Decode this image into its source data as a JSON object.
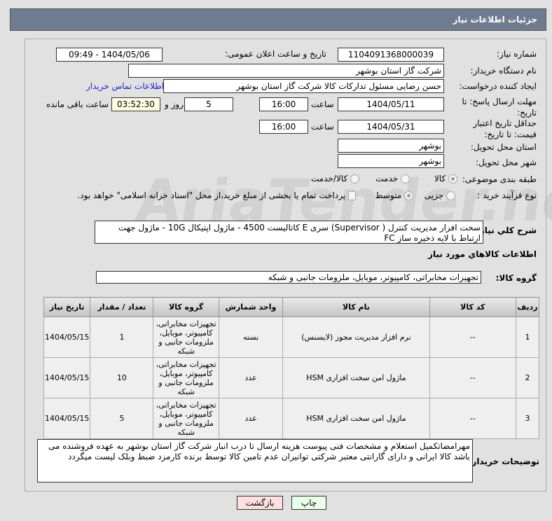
{
  "header": {
    "title": "جزئیات اطلاعات نیاز"
  },
  "watermark": "AriaTender.net",
  "fields": {
    "need_number_label": "شماره نیاز:",
    "need_number": "1104091368000039",
    "announce_label": "تاریخ و ساعت اعلان عمومی:",
    "announce_value": "1404/05/06 - 09:49",
    "buyer_org_label": "نام دستگاه خریدار:",
    "buyer_org": "شرکت گاز استان بوشهر",
    "creator_label": "ایجاد کننده درخواست:",
    "creator": "حسن رضایی مسئول تدارکات کالا شرکت گاز استان بوشهر",
    "contact_link": "اطلاعات تماس خریدار",
    "deadline_label": "مهلت ارسال پاسخ: تا تاریخ:",
    "deadline_date": "1404/05/11",
    "time_label": "ساعت",
    "deadline_time": "16:00",
    "days": "5",
    "days_label": "روز و",
    "remaining": "03:52:30",
    "remaining_label": "ساعت باقی مانده",
    "validity_label": "حداقل تاریخ اعتبار قیمت: تا تاریخ:",
    "validity_date": "1404/05/31",
    "validity_time": "16:00",
    "province_label": "استان محل تحویل:",
    "province": "بوشهر",
    "city_label": "شهر محل تحویل:",
    "city": "بوشهر",
    "category_label": "طبقه بندی موضوعی:",
    "cat_options": [
      "کالا",
      "خدمت",
      "کالا/خدمت"
    ],
    "process_label": "نوع فرآیند خرید :",
    "process_options": [
      "جزیی",
      "متوسط"
    ],
    "payment_note": "پرداخت تمام یا بخشی از مبلغ خرید،از محل \"اسناد خزانه اسلامی\" خواهد بود.",
    "desc_label": "شرح کلي نياز:",
    "desc": "سخت افزار مدیریت کنترل ( Supervisor) سری E  کاتالیست 4500 - ماژول اپتیکال 10G - ماژول جهت ارتباط با لایه ذخیره ساز FC",
    "goods_info_title": "اطلاعات کالاهاي مورد نياز",
    "group_label": "گروه کالا:",
    "group": "تجهیزات مخابراتی، کامپیوتر، موبایل، ملزومات جانبی و شبکه"
  },
  "table": {
    "headers": [
      "ردیف",
      "کد کالا",
      "نام کالا",
      "واحد شمارش",
      "گروه کالا",
      "تعداد / مقدار",
      "تاریخ نیاز"
    ],
    "rows": [
      [
        "1",
        "--",
        "نرم افزار مدیریت مجوز (لایسنس)",
        "بسته",
        "تجهیزات مخابراتی، کامپیوتر، موبایل، ملزومات جانبی و شبکه",
        "1",
        "1404/05/15"
      ],
      [
        "2",
        "--",
        "ماژول امن سخت افزاری HSM",
        "عدد",
        "تجهیزات مخابراتی، کامپیوتر، موبایل، ملزومات جانبی و شبکه",
        "10",
        "1404/05/15"
      ],
      [
        "3",
        "--",
        "ماژول امن سخت افزاری HSM",
        "عدد",
        "تجهیزات مخابراتی، کامپیوتر، موبایل، ملزومات جانبی و شبکه",
        "5",
        "1404/05/15"
      ]
    ]
  },
  "notes": {
    "label": "توضیحات خریدار:",
    "text": "مهرامضاتکمیل استعلام و مشخصات فنی پیوست هزینه ارسال تا درب انبار شرکت گاز استان بوشهر به عهده فروشنده می باشد کالا ایرانی و دارای گارانتی معتبر شرکتی توانیران عدم تامین کالا توسط برنده کارمزد ضبط وبلک لیست میگردد"
  },
  "buttons": {
    "print": "چاپ",
    "back": "بازگشت"
  }
}
